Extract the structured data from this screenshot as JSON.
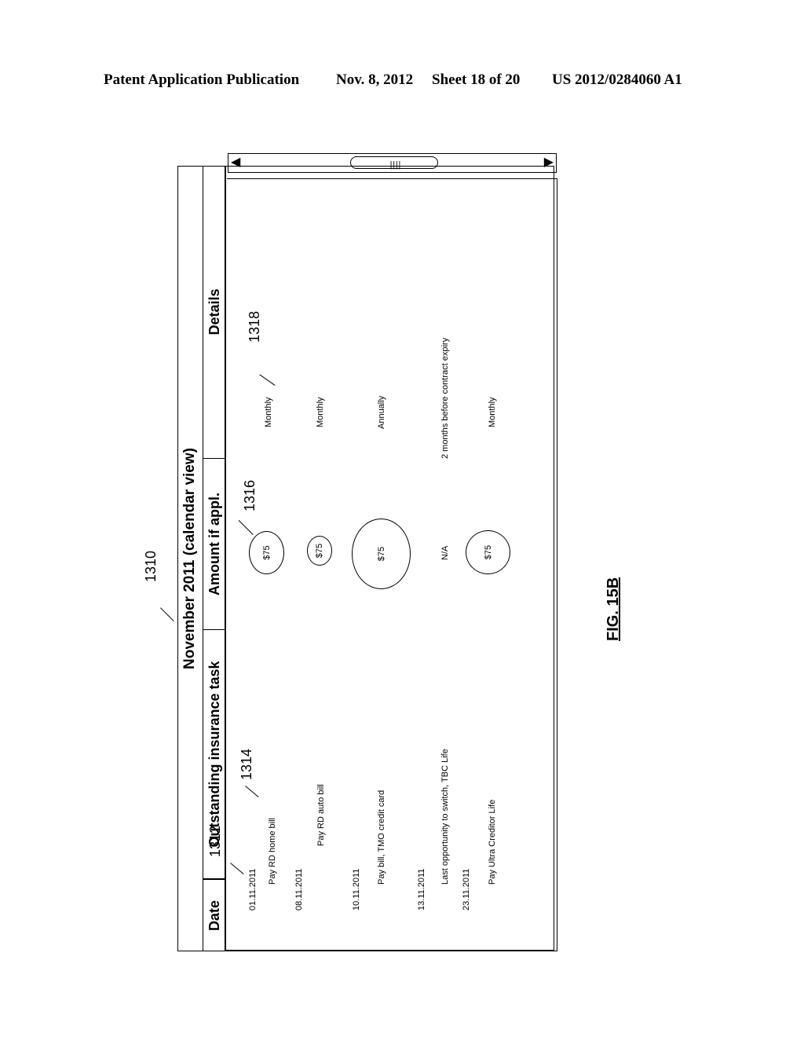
{
  "header": {
    "publication": "Patent Application Publication",
    "date": "Nov. 8, 2012",
    "sheet": "Sheet 18 of 20",
    "number": "US 2012/0284060 A1"
  },
  "figure": {
    "label": "FIG. 15B",
    "title": "November 2011 (calendar view)",
    "columns": {
      "date": "Date",
      "task": "Outstanding insurance task",
      "amount": "Amount if appl.",
      "details": "Details"
    },
    "rows": [
      {
        "date": "01.11.2011",
        "task": "Pay RD home bill",
        "amount": "$75",
        "details": "Monthly"
      },
      {
        "date": "08.11.2011",
        "task": "Pay RD auto bill",
        "amount": "$75",
        "details": "Monthly"
      },
      {
        "date": "10.11.2011",
        "task": "Pay bill, TMO credit card",
        "amount": "$75",
        "details": "Annually"
      },
      {
        "date": "13.11.2011",
        "task": "Last opportunity to switch, TBC Life",
        "amount": "N/A",
        "details": "2 months before contract expiry"
      },
      {
        "date": "23.11.2011",
        "task": "Pay Ultra Creditor Life",
        "amount": "$75",
        "details": "Monthly"
      }
    ],
    "reference_numerals": {
      "view": "1310",
      "date_entry": "1312",
      "task_entry": "1314",
      "amount_bubble": "1316",
      "details_entry": "1318"
    },
    "scrollbar": {
      "left_arrow": "◀",
      "right_arrow": "▶",
      "thumb_grip": "||||"
    }
  }
}
